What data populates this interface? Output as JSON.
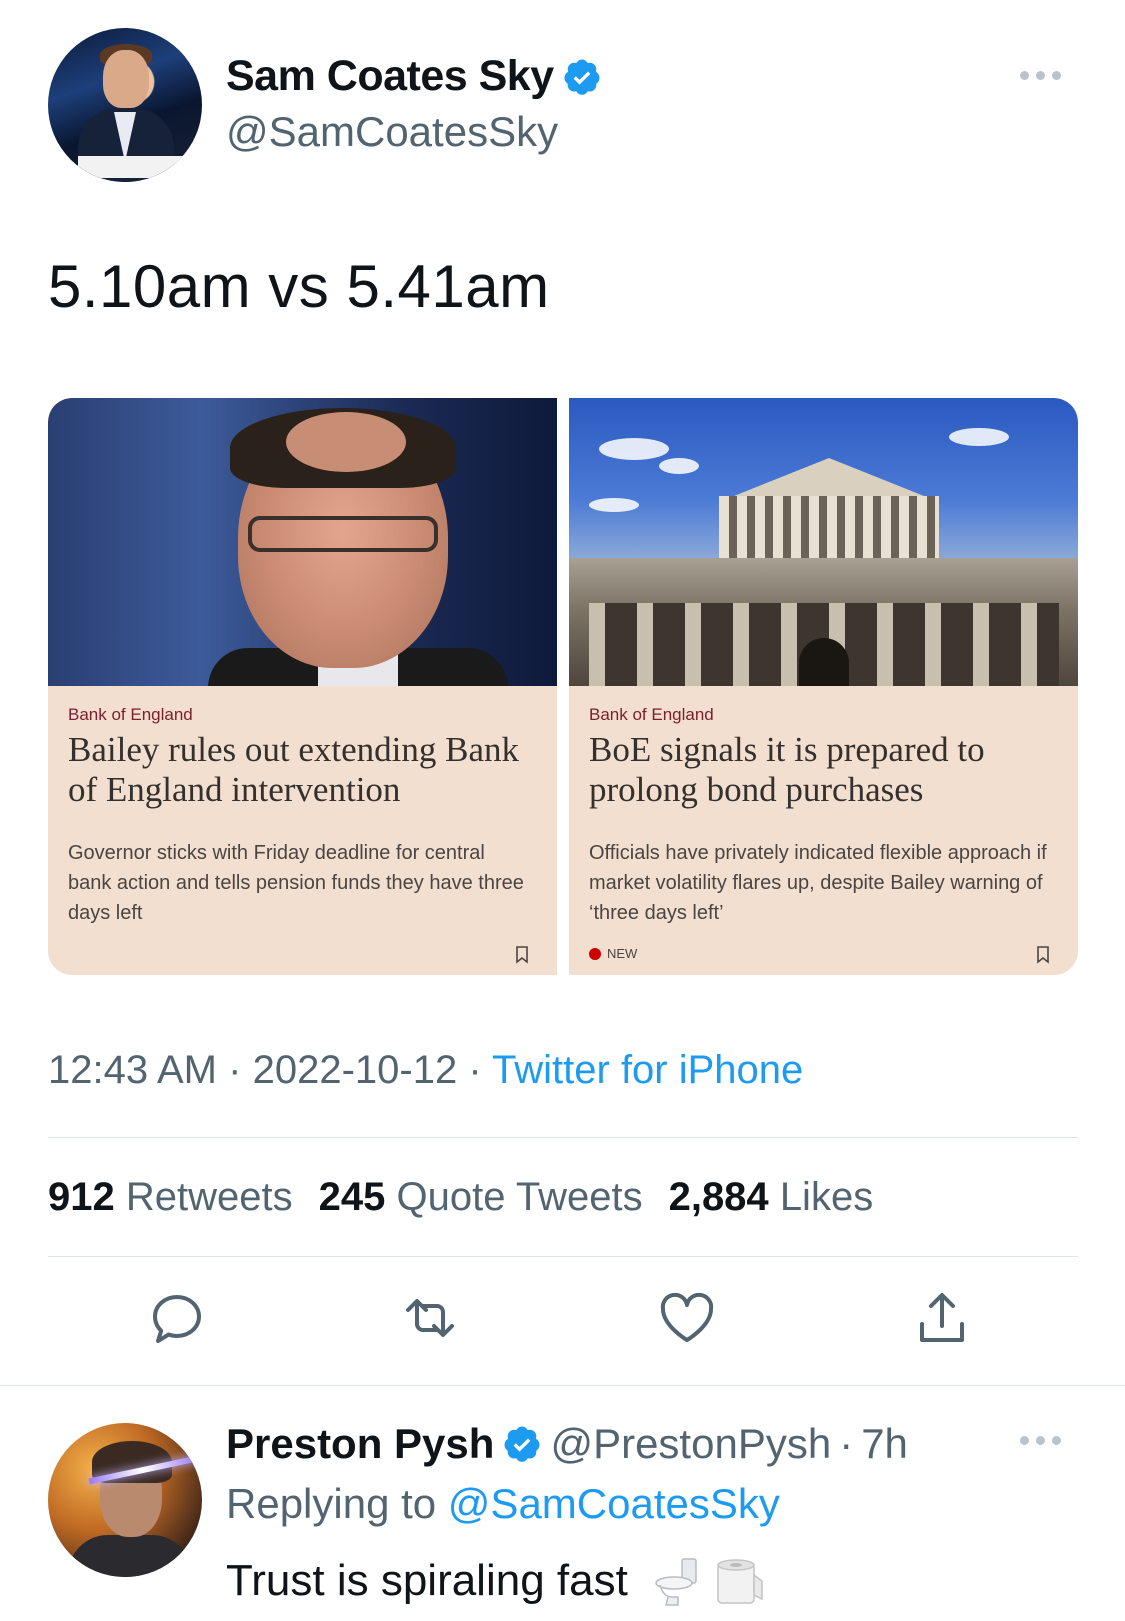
{
  "tweet": {
    "author_name": "Sam Coates Sky",
    "author_handle": "@SamCoatesSky",
    "text": "5.10am vs 5.41am",
    "time": "12:43 AM",
    "date": "2022-10-12",
    "source": "Twitter for iPhone",
    "stats": {
      "retweets_count": "912",
      "retweets_label": "Retweets",
      "quotes_count": "245",
      "quotes_label": "Quote Tweets",
      "likes_count": "2,884",
      "likes_label": "Likes"
    }
  },
  "cards": [
    {
      "kicker": "Bank of England",
      "headline": "Bailey rules out extending Bank of England intervention",
      "summary": "Governor sticks with Friday deadline for central bank action and tells pension funds they have three days left"
    },
    {
      "kicker": "Bank of England",
      "headline": "BoE signals it is prepared to prolong bond purchases",
      "summary": "Officials have privately indicated flexible approach if market volatility flares up, despite Bailey warning of ‘three days left’",
      "badge": "NEW"
    }
  ],
  "reply": {
    "author_name": "Preston Pysh",
    "author_handle": "@PrestonPysh",
    "age": "7h",
    "replying_label": "Replying to",
    "replying_to": "@SamCoatesSky",
    "text": "Trust is spiraling fast",
    "emojis": [
      "toilet-icon",
      "toilet-paper-icon"
    ]
  },
  "colors": {
    "link": "#1d9bf0",
    "secondary_text": "#536471",
    "card_background": "#f2dfd0",
    "kicker": "#7d1e2e"
  }
}
